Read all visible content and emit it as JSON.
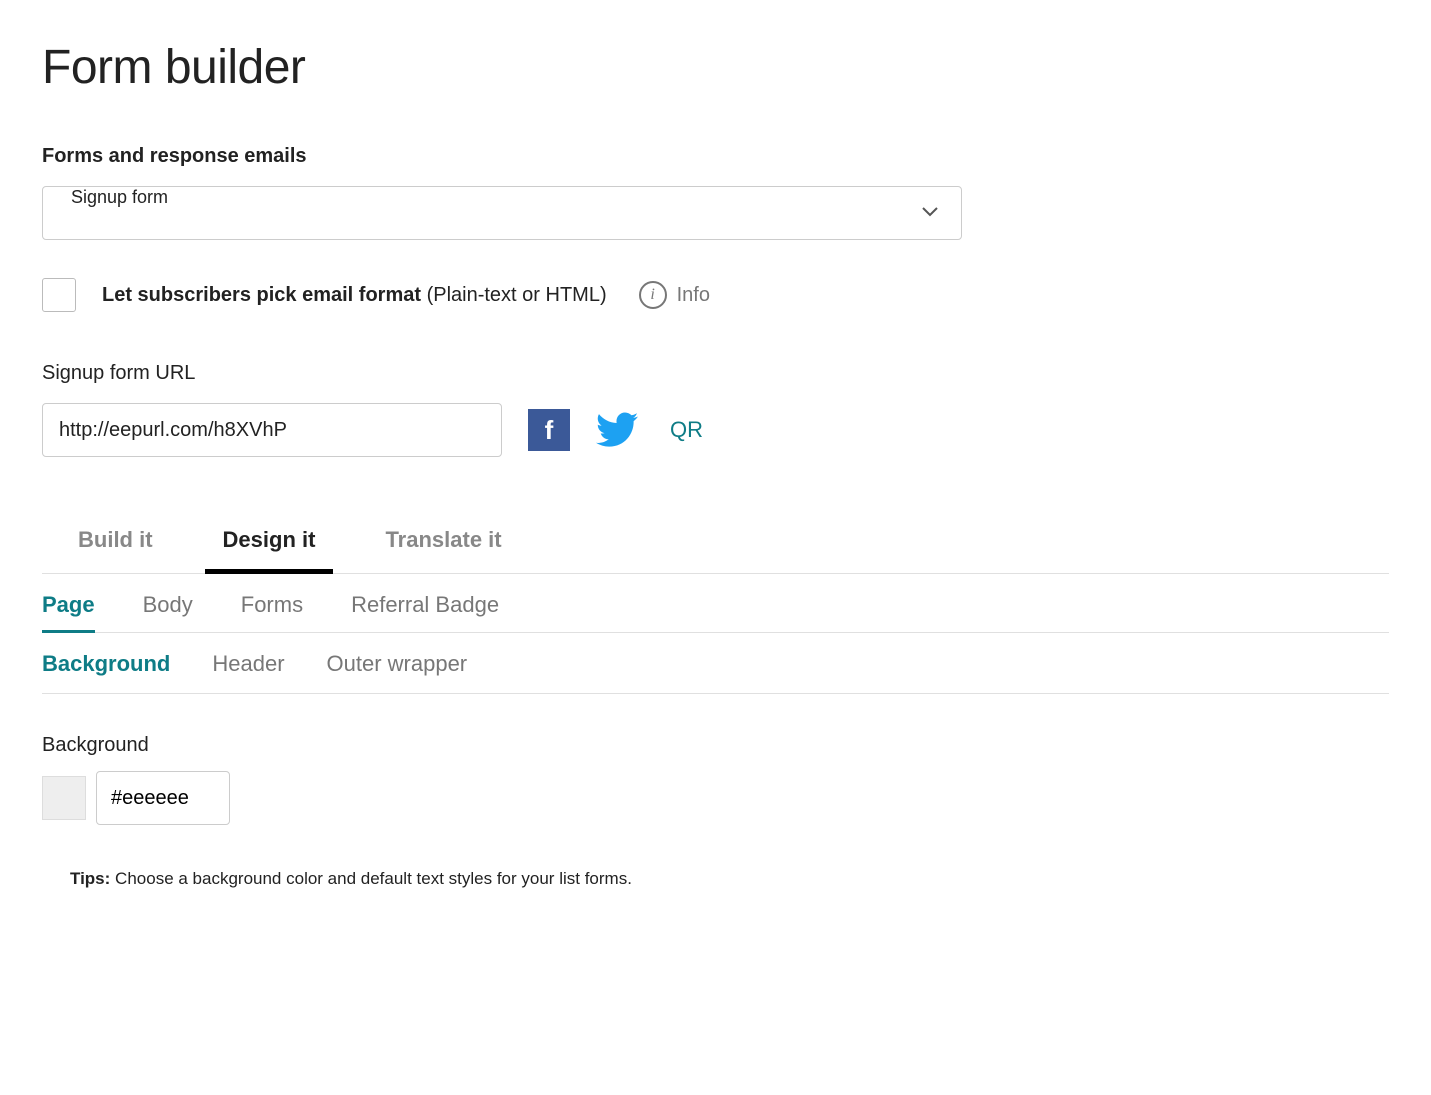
{
  "page_title": "Form builder",
  "forms_section": {
    "label": "Forms and response emails",
    "selected": "Signup form"
  },
  "checkbox": {
    "label_bold": "Let subscribers pick email format",
    "label_suffix": "(Plain-text or HTML)",
    "info_text": "Info"
  },
  "url_section": {
    "label": "Signup form URL",
    "value": "http://eepurl.com/h8XVhP",
    "qr_label": "QR"
  },
  "tabs_main": [
    {
      "label": "Build it",
      "active": false
    },
    {
      "label": "Design it",
      "active": true
    },
    {
      "label": "Translate it",
      "active": false
    }
  ],
  "tabs_sub": [
    {
      "label": "Page",
      "active": true
    },
    {
      "label": "Body",
      "active": false
    },
    {
      "label": "Forms",
      "active": false
    },
    {
      "label": "Referral Badge",
      "active": false
    }
  ],
  "tabs_tert": [
    {
      "label": "Background",
      "active": true
    },
    {
      "label": "Header",
      "active": false
    },
    {
      "label": "Outer wrapper",
      "active": false
    }
  ],
  "background": {
    "label": "Background",
    "value": "#eeeeee"
  },
  "tips": {
    "label": "Tips:",
    "text": "Choose a background color and default text styles for your list forms."
  }
}
